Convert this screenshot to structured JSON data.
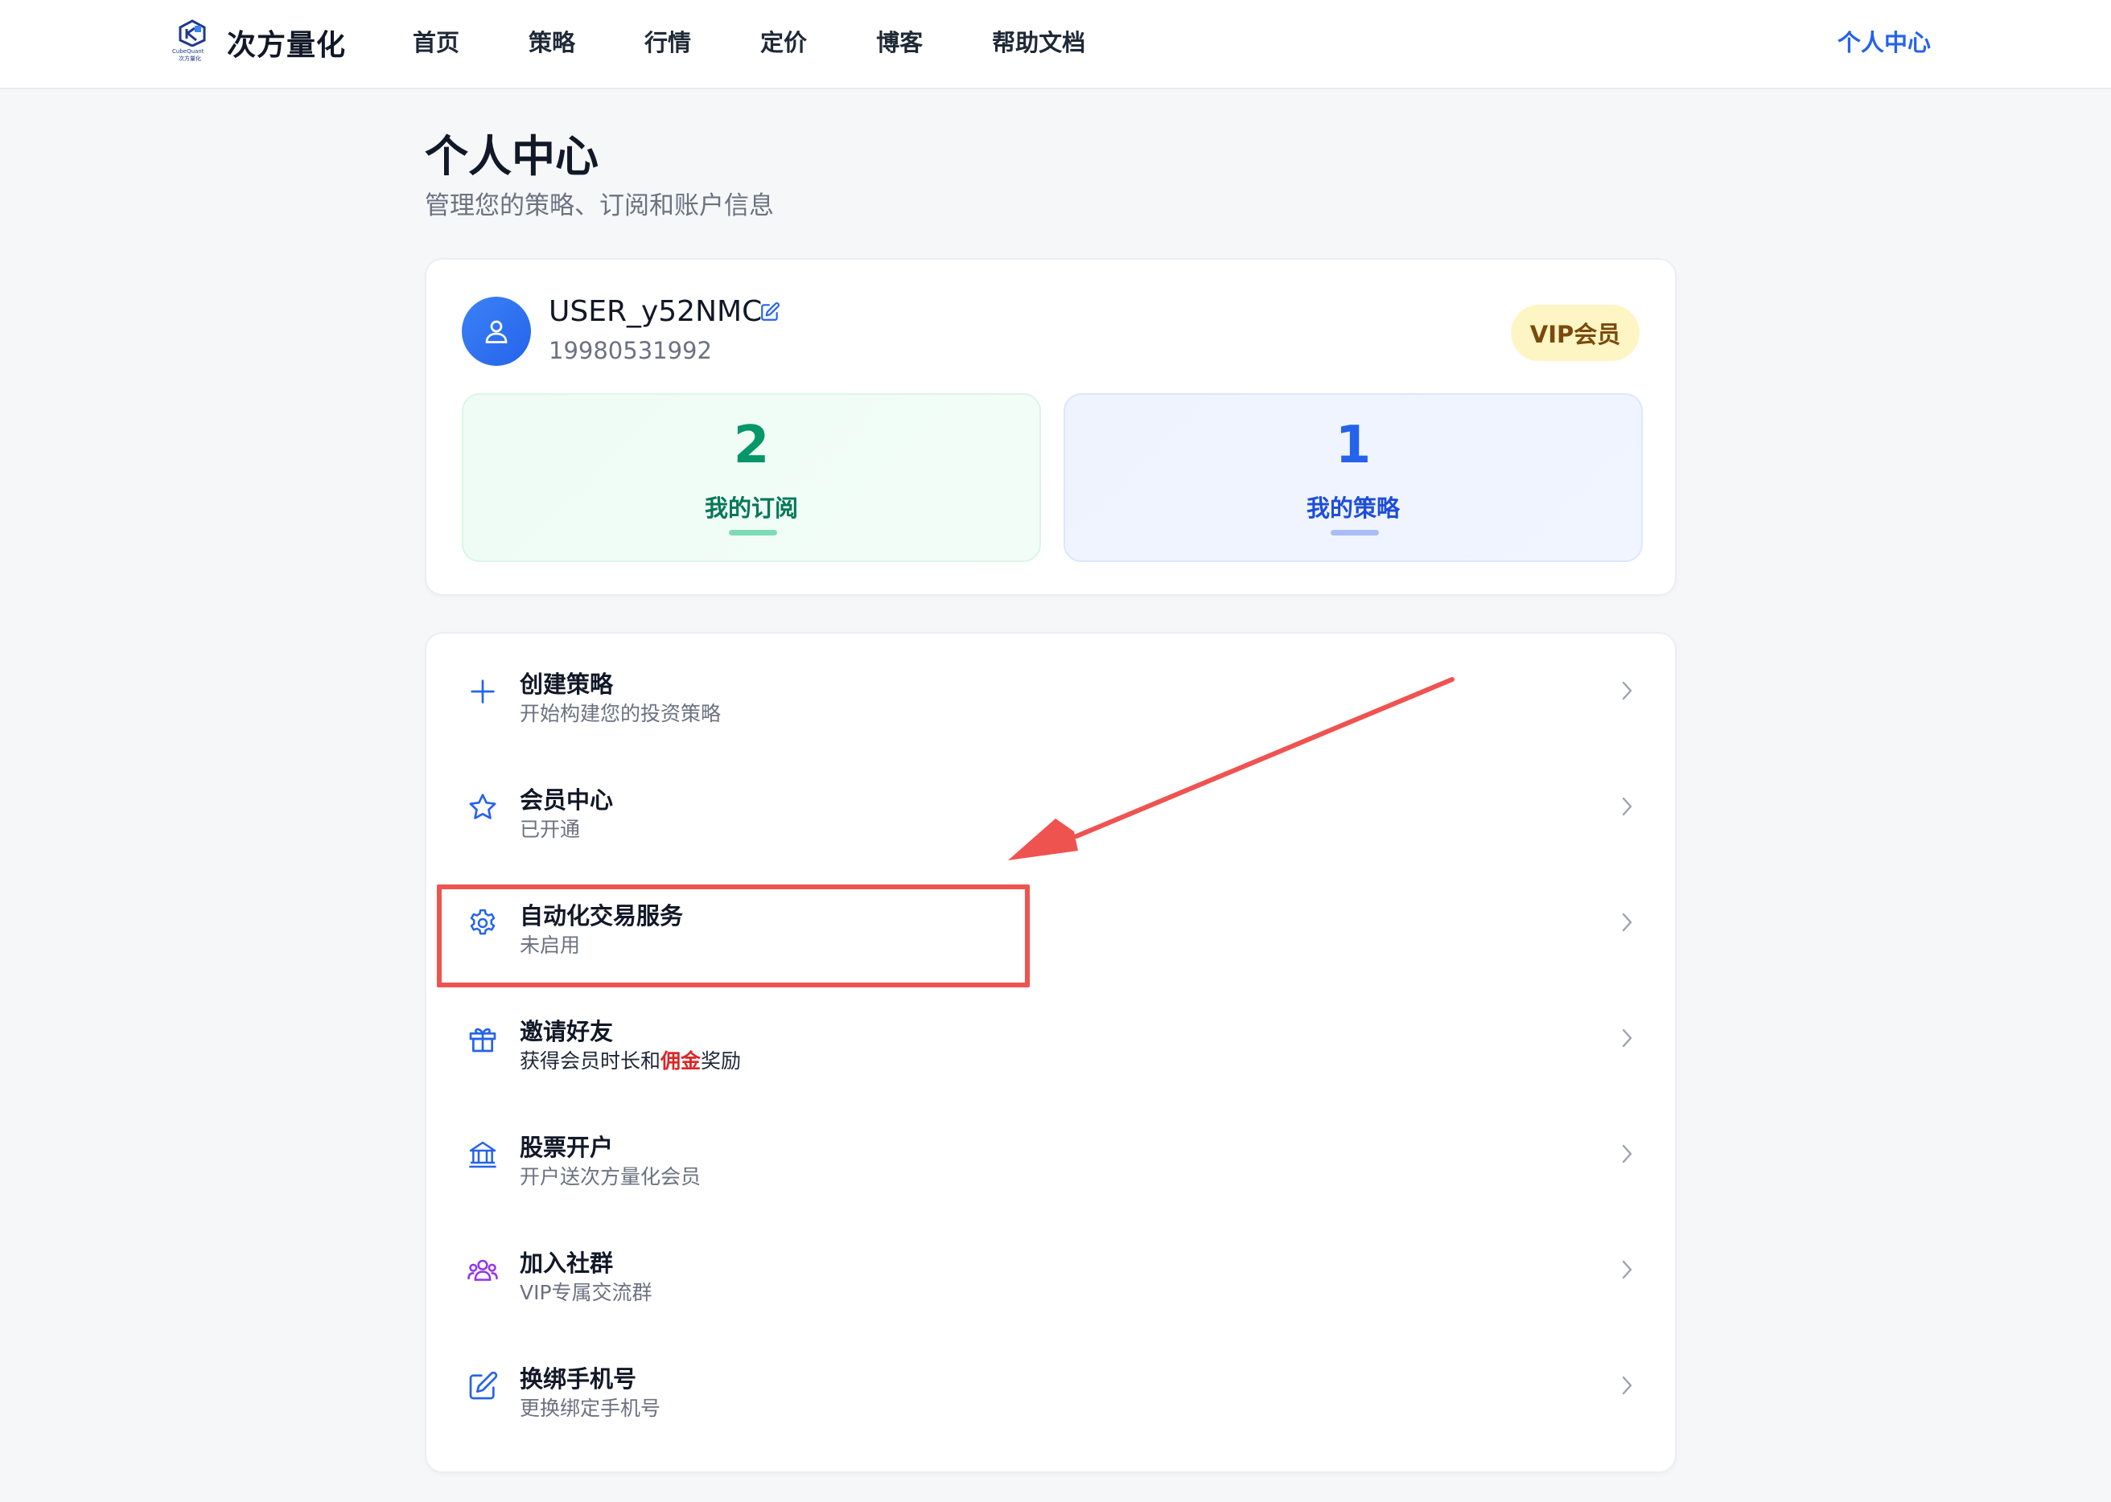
{
  "nav": {
    "brand": "次方量化",
    "brand_tiny_1": "CubeQuant",
    "brand_tiny_2": "次方量化",
    "items": [
      "首页",
      "策略",
      "行情",
      "定价",
      "博客",
      "帮助文档"
    ],
    "account": "个人中心"
  },
  "header": {
    "title": "个人中心",
    "subtitle": "管理您的策略、订阅和账户信息"
  },
  "profile": {
    "username": "USER_y52NMC",
    "phone": "19980531992",
    "badge": "VIP会员",
    "stats": [
      {
        "value": "2",
        "label": "我的订阅"
      },
      {
        "value": "1",
        "label": "我的策略"
      }
    ]
  },
  "menu": [
    {
      "title": "创建策略",
      "desc": "开始构建您的投资策略",
      "icon": "plus-icon"
    },
    {
      "title": "会员中心",
      "desc": "已开通",
      "icon": "star-icon"
    },
    {
      "title": "自动化交易服务",
      "desc": "未启用",
      "icon": "gear-icon"
    },
    {
      "title": "邀请好友",
      "desc_pre": "获得会员时长和",
      "desc_red": "佣金",
      "desc_post": "奖励",
      "icon": "gift-icon"
    },
    {
      "title": "股票开户",
      "desc": "开户送次方量化会员",
      "icon": "bank-icon"
    },
    {
      "title": "加入社群",
      "desc": "VIP专属交流群",
      "icon": "users-icon"
    },
    {
      "title": "换绑手机号",
      "desc": "更换绑定手机号",
      "icon": "edit-square-icon"
    }
  ],
  "colors": {
    "accent": "#2563eb",
    "annotation": "#ef5350",
    "group_icon": "#9333ea"
  }
}
